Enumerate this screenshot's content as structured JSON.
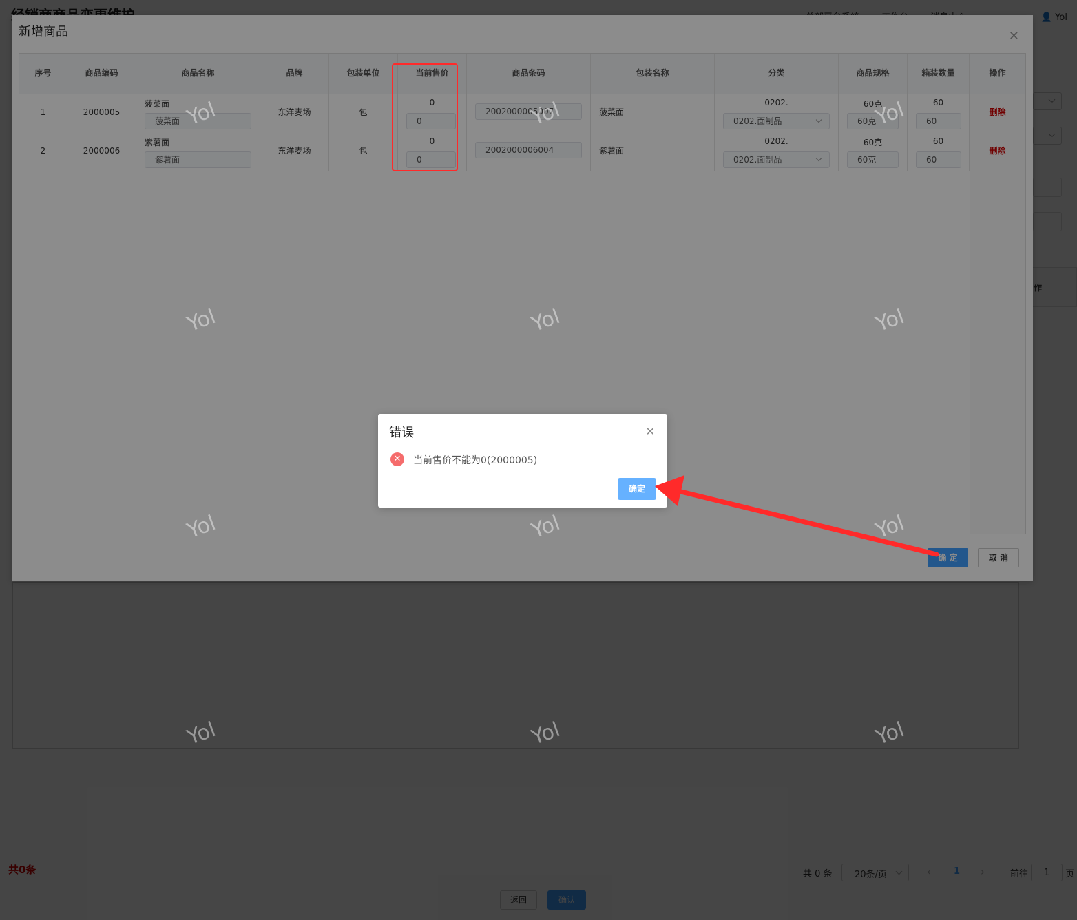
{
  "page": {
    "title": "经销商商品变更维护",
    "header_links": [
      "总部平台系统",
      "工作台",
      "消息中心"
    ],
    "user_name": "Yol"
  },
  "background": {
    "op_header": "作",
    "footer_total": "共0条",
    "pager": {
      "total": "共 0 条",
      "page_size": "20条/页",
      "current_page": "1",
      "goto_label": "前往",
      "goto_value": "1",
      "page_suffix": "页"
    },
    "return_label": "返回",
    "confirm_label": "确认"
  },
  "add_dialog": {
    "title": "新增商品",
    "columns": [
      "序号",
      "商品编码",
      "商品名称",
      "品牌",
      "包装单位",
      "当前售价",
      "商品条码",
      "包装名称",
      "分类",
      "商品规格",
      "箱装数量",
      "操作"
    ],
    "rows": [
      {
        "index": "1",
        "code": "2000005",
        "name": "菠菜面",
        "name_input": "菠菜面",
        "brand": "东洋麦场",
        "unit": "包",
        "price": "0",
        "price_input": "0",
        "barcode": "2002000005007",
        "pack_name": "菠菜面",
        "category": "0202.",
        "category_select": "0202.面制品",
        "spec": "60克",
        "spec_input": "60克",
        "box_qty": "60",
        "box_qty_input": "60",
        "action": "删除"
      },
      {
        "index": "2",
        "code": "2000006",
        "name": "紫薯面",
        "name_input": "紫薯面",
        "brand": "东洋麦场",
        "unit": "包",
        "price": "0",
        "price_input": "0",
        "barcode": "2002000006004",
        "pack_name": "紫薯面",
        "category": "0202.",
        "category_select": "0202.面制品",
        "spec": "60克",
        "spec_input": "60克",
        "box_qty": "60",
        "box_qty_input": "60",
        "action": "删除"
      }
    ],
    "ok_label": "确 定",
    "cancel_label": "取 消"
  },
  "error_box": {
    "title": "错误",
    "message": "当前售价不能为0(2000005)",
    "ok_label": "确定"
  },
  "watermark_text": "Yol",
  "colors": {
    "primary": "#409eff",
    "danger": "#f56c6c",
    "annotation_red": "#ff2a2a",
    "delete_text": "#cc0000"
  }
}
